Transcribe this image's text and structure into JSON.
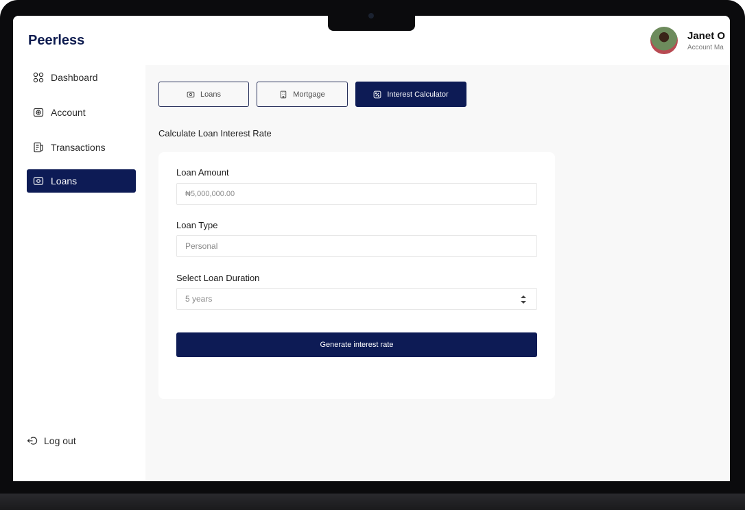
{
  "app": {
    "brand": "Peerless"
  },
  "user": {
    "name": "Janet O",
    "role": "Account Ma"
  },
  "sidebar": {
    "items": [
      {
        "label": "Dashboard",
        "icon": "dashboard-grid-icon"
      },
      {
        "label": "Account",
        "icon": "account-icon"
      },
      {
        "label": "Transactions",
        "icon": "transactions-icon"
      },
      {
        "label": "Loans",
        "icon": "loans-cash-icon",
        "active": true
      }
    ],
    "logout": "Log out"
  },
  "tabs": [
    {
      "label": "Loans",
      "icon": "cash-icon"
    },
    {
      "label": "Mortgage",
      "icon": "building-icon"
    },
    {
      "label": "Interest Calculator",
      "icon": "percent-icon",
      "active": true
    }
  ],
  "main": {
    "section_title": "Calculate Loan Interest Rate",
    "form": {
      "amount_label": "Loan Amount",
      "amount_value": "₦5,000,000.00",
      "type_label": "Loan Type",
      "type_value": "Personal",
      "duration_label": "Select Loan Duration",
      "duration_value": "5 years",
      "submit_label": "Generate interest rate"
    }
  },
  "colors": {
    "primary": "#0d1b55",
    "background": "#f8f8f8",
    "card": "#ffffff"
  }
}
